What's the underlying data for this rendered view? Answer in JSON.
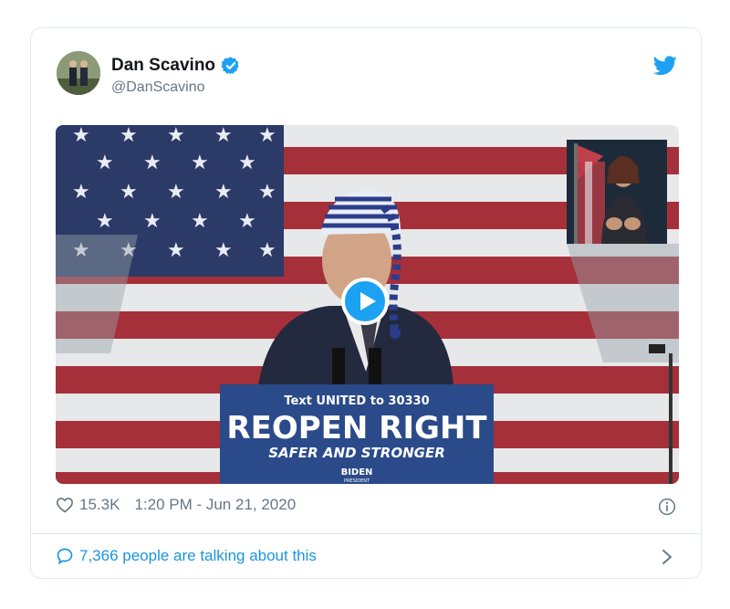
{
  "tweet": {
    "author_name": "Dan Scavino",
    "author_handle": "@DanScavino",
    "verified": true
  },
  "media": {
    "type": "video",
    "sign_line1": "Text UNITED to 30330",
    "sign_line2": "REOPEN RIGHT",
    "sign_line3": "SAFER AND STRONGER",
    "sign_logo": "BIDEN",
    "sign_logo_sub": "PRESIDENT"
  },
  "meta": {
    "likes": "15.3K",
    "timestamp": "1:20 PM - Jun 21, 2020"
  },
  "footer": {
    "talking": "7,366 people are talking about this"
  },
  "icons": {
    "verified": "verified-badge-icon",
    "brand": "twitter-bird-icon",
    "like": "heart-icon",
    "info": "info-icon",
    "reply": "speech-bubble-icon",
    "more": "chevron-right-icon",
    "play": "play-icon"
  },
  "colors": {
    "accent": "#1da1f2",
    "link": "#1b95e0",
    "muted": "#657786",
    "border": "#e1e8ed",
    "flag_red": "#a5303a",
    "flag_blue": "#2b3a67",
    "sign_blue": "#2a4a8a"
  }
}
